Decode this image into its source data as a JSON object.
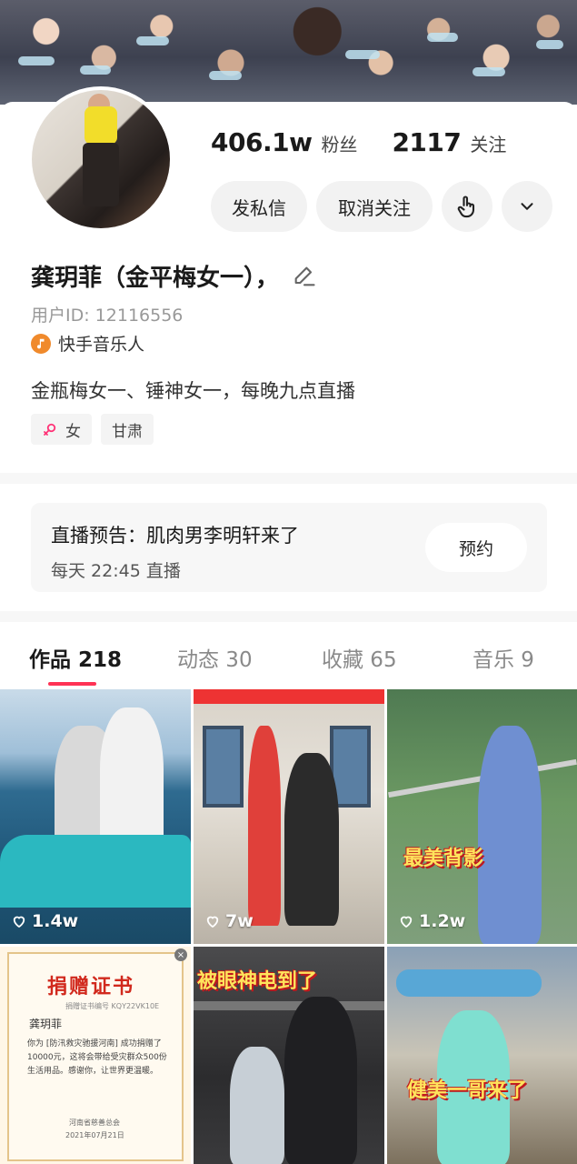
{
  "profile": {
    "followers_count": "406.1w",
    "followers_label": "粉丝",
    "following_count": "2117",
    "following_label": "关注",
    "message_label": "发私信",
    "unfollow_label": "取消关注",
    "name": "龚玥菲（金平梅女一），",
    "user_id": "用户ID: 12116556",
    "badge": "快手音乐人",
    "bio": "金瓶梅女一、锤神女一，每晚九点直播",
    "gender_tag": "女",
    "location_tag": "甘肃"
  },
  "live_preview": {
    "title": "直播预告：肌肉男李明轩来了",
    "time": "每天 22:45 直播",
    "reserve_label": "预约"
  },
  "tabs": [
    {
      "label": "作品 218",
      "active": true
    },
    {
      "label": "动态 30",
      "active": false
    },
    {
      "label": "收藏 65",
      "active": false
    },
    {
      "label": "音乐 9",
      "active": false
    }
  ],
  "videos": [
    {
      "likes": "1.4w",
      "overlay": ""
    },
    {
      "likes": "7w",
      "overlay": ""
    },
    {
      "likes": "1.2w",
      "overlay": "最美背影"
    },
    {
      "likes": "",
      "overlay": ""
    },
    {
      "likes": "",
      "overlay": "被眼神电到了"
    },
    {
      "likes": "",
      "overlay": "健美一哥来了"
    }
  ],
  "certificate": {
    "title": "捐赠证书",
    "number": "捐赠证书编号 KQY22VK10E",
    "name": "龚玥菲",
    "body": "你为 [防汛救灾驰援河南] 成功捐赠了 10000元，这将会带给受灾群众500份生活用品。感谢你，让世界更温暖。",
    "org": "河南省慈善总会",
    "date": "2021年07月21日"
  },
  "colors": {
    "accent": "#ff3355",
    "music_badge": "#f08a2c",
    "gender_icon": "#ff3377"
  }
}
